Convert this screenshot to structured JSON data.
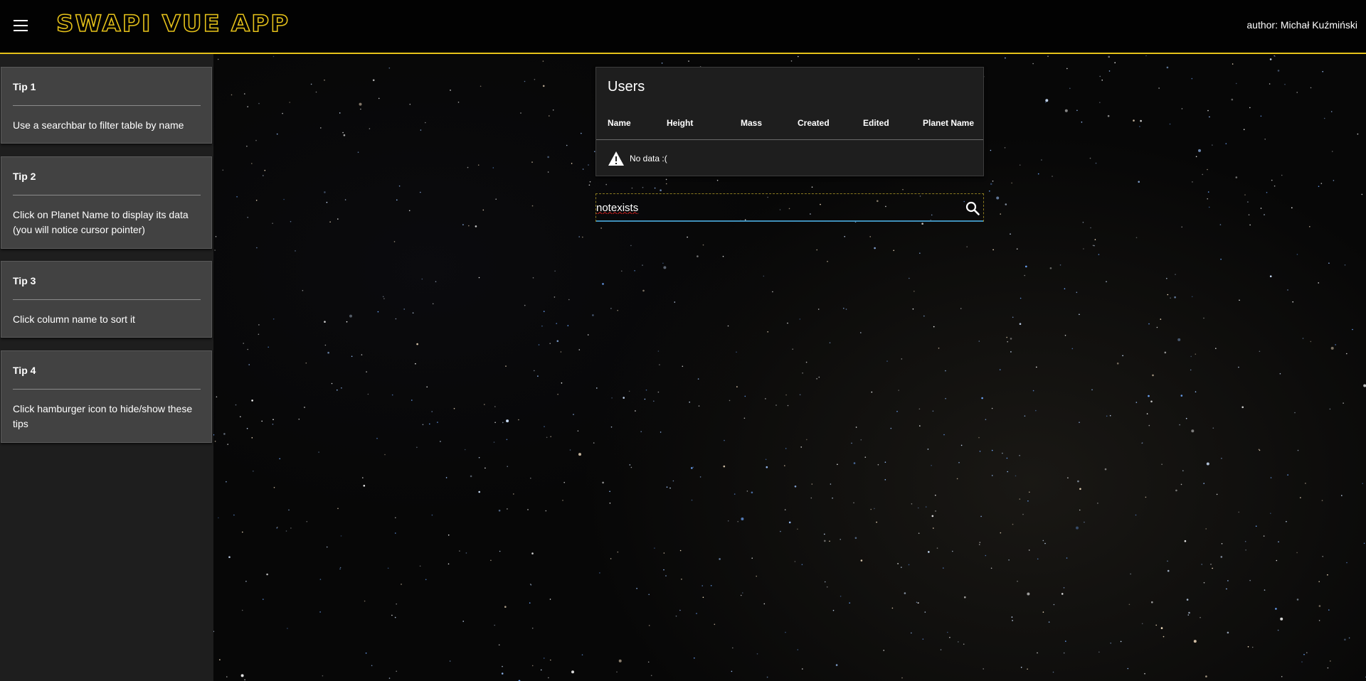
{
  "header": {
    "logo": "SWAPI VUE APP",
    "author": "author: Michał Kuźmiński",
    "menu_icon": "hamburger-icon"
  },
  "sidebar": {
    "tips": [
      {
        "title": "Tip 1",
        "text": "Use a searchbar to filter table by name"
      },
      {
        "title": "Tip 2",
        "text": "Click on Planet Name to display its data (you will notice cursor pointer)"
      },
      {
        "title": "Tip 3",
        "text": "Click column name to sort it"
      },
      {
        "title": "Tip 4",
        "text": "Click hamburger icon to hide/show these tips"
      }
    ]
  },
  "users_table": {
    "title": "Users",
    "columns": [
      "Name",
      "Height",
      "Mass",
      "Created",
      "Edited",
      "Planet Name"
    ],
    "empty_icon": "warning-icon",
    "empty_text": "No data :("
  },
  "search": {
    "value": "notexists",
    "icon": "search-icon"
  },
  "colors": {
    "accent": "#e6c21a",
    "card": "#1e1e1e",
    "tip_card": "#424242",
    "focus_underline": "#3f8fb9"
  }
}
